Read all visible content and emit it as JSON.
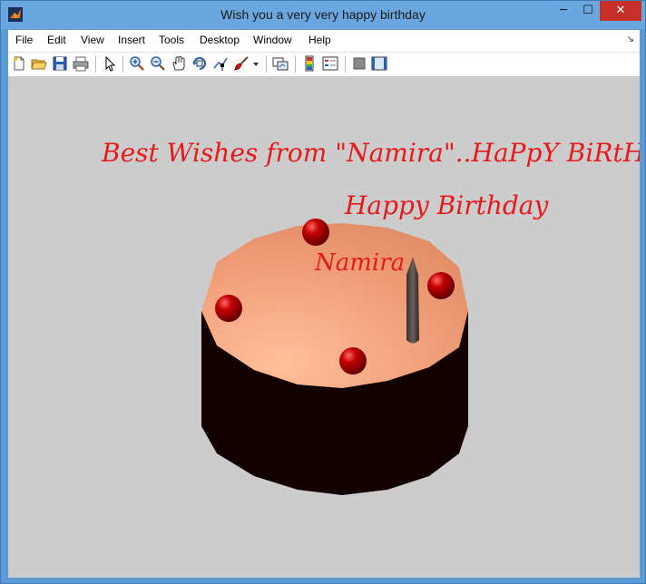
{
  "window": {
    "title": "Wish you a very very happy birthday",
    "controls": {
      "minimize": "─",
      "maximize": "☐",
      "close": "✕"
    }
  },
  "menubar": {
    "items": [
      "File",
      "Edit",
      "View",
      "Insert",
      "Tools",
      "Desktop",
      "Window",
      "Help"
    ],
    "overflow_arrow": "↘"
  },
  "toolbar": {
    "icons": [
      "new-figure-icon",
      "open-file-icon",
      "save-icon",
      "print-icon",
      "pointer-icon",
      "zoom-in-icon",
      "zoom-out-icon",
      "pan-hand-icon",
      "rotate-3d-icon",
      "data-cursor-icon",
      "brush-icon",
      "brush-dropdown-icon",
      "link-plot-icon",
      "colorbar-icon",
      "legend-icon",
      "hide-plot-tools-icon",
      "show-plot-tools-icon"
    ]
  },
  "figure": {
    "text_best_wishes": "Best Wishes from \"Namira\"..HaPpY BiRtHdAy",
    "text_happy_birthday": "Happy Birthday",
    "text_name": "Namira",
    "colors": {
      "text": "#e8191b",
      "background": "#cccccc",
      "cake_side": "#130000",
      "cake_top": "#f4a582",
      "cherry": "#b40000",
      "candle": "#4a3f3d"
    }
  }
}
